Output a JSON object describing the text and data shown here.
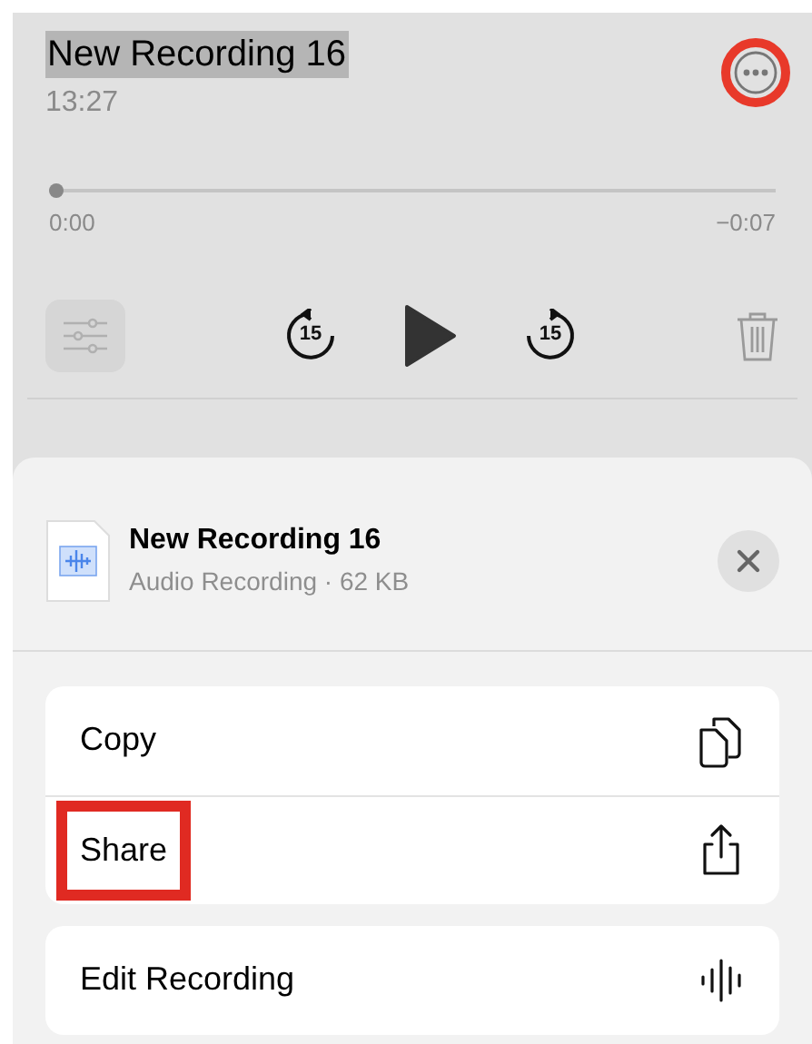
{
  "recording": {
    "title": "New Recording 16",
    "title_selected": true,
    "time": "13:27",
    "more_annotated": true
  },
  "playback": {
    "level": 0,
    "elapsed": "0:00",
    "remaining": "−0:07",
    "skip_back": "15",
    "skip_forward": "15"
  },
  "sheet": {
    "file_name": "New Recording 16",
    "file_info": "Audio Recording · 62 KB"
  },
  "action_groups": [
    {
      "actions": [
        {
          "label": "Copy",
          "kind": "copy",
          "annotated": false
        },
        {
          "label": "Share",
          "kind": "share",
          "annotated": true
        }
      ]
    },
    {
      "actions": [
        {
          "label": "Edit Recording",
          "kind": "edit",
          "annotated": false
        }
      ]
    }
  ]
}
